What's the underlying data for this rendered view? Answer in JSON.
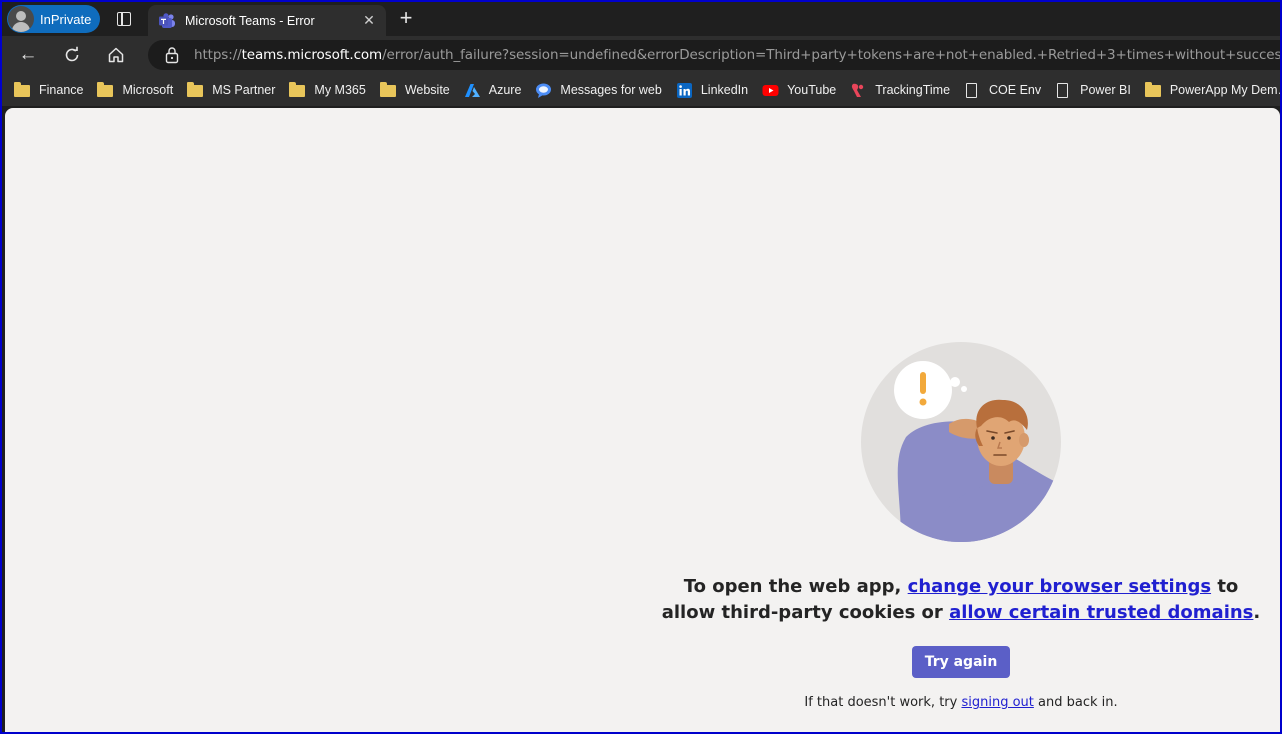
{
  "browser": {
    "inprivate_label": "InPrivate",
    "tab": {
      "title": "Microsoft Teams - Error",
      "close": "✕"
    },
    "new_tab": "+",
    "back": "←",
    "address": {
      "scheme": "https://",
      "host": "teams.microsoft.com",
      "path": "/error/auth_failure?session=undefined&errorDescription=Third+party+tokens+are+not+enabled.+Retried+3+times+without+success.&errorMessage…"
    },
    "bookmarks": [
      {
        "label": "Finance",
        "icon": "folder-icon"
      },
      {
        "label": "Microsoft",
        "icon": "folder-icon"
      },
      {
        "label": "MS Partner",
        "icon": "folder-icon"
      },
      {
        "label": "My M365",
        "icon": "folder-icon"
      },
      {
        "label": "Website",
        "icon": "folder-icon"
      },
      {
        "label": "Azure",
        "icon": "azure-icon"
      },
      {
        "label": "Messages for web",
        "icon": "messages-icon"
      },
      {
        "label": "LinkedIn",
        "icon": "linkedin-icon"
      },
      {
        "label": "YouTube",
        "icon": "youtube-icon"
      },
      {
        "label": "TrackingTime",
        "icon": "trackingtime-icon"
      },
      {
        "label": "COE Env",
        "icon": "document-icon"
      },
      {
        "label": "Power BI",
        "icon": "document-icon"
      },
      {
        "label": "PowerApp My Dem…",
        "icon": "folder-icon"
      }
    ]
  },
  "page": {
    "message_before": "To open the web app, ",
    "link_browser_settings": "change your browser settings",
    "message_middle": " to allow third-party cookies or ",
    "link_trusted_domains": "allow certain trusted domains",
    "message_after": ".",
    "try_again": "Try again",
    "hint_before": "If that doesn't work, try ",
    "hint_link": "signing out",
    "hint_after": " and back in."
  },
  "colors": {
    "accent": "#5b5fc7",
    "link": "#2020d0",
    "inprivate": "#0f6cbd",
    "page_bg": "#f3f2f1"
  }
}
